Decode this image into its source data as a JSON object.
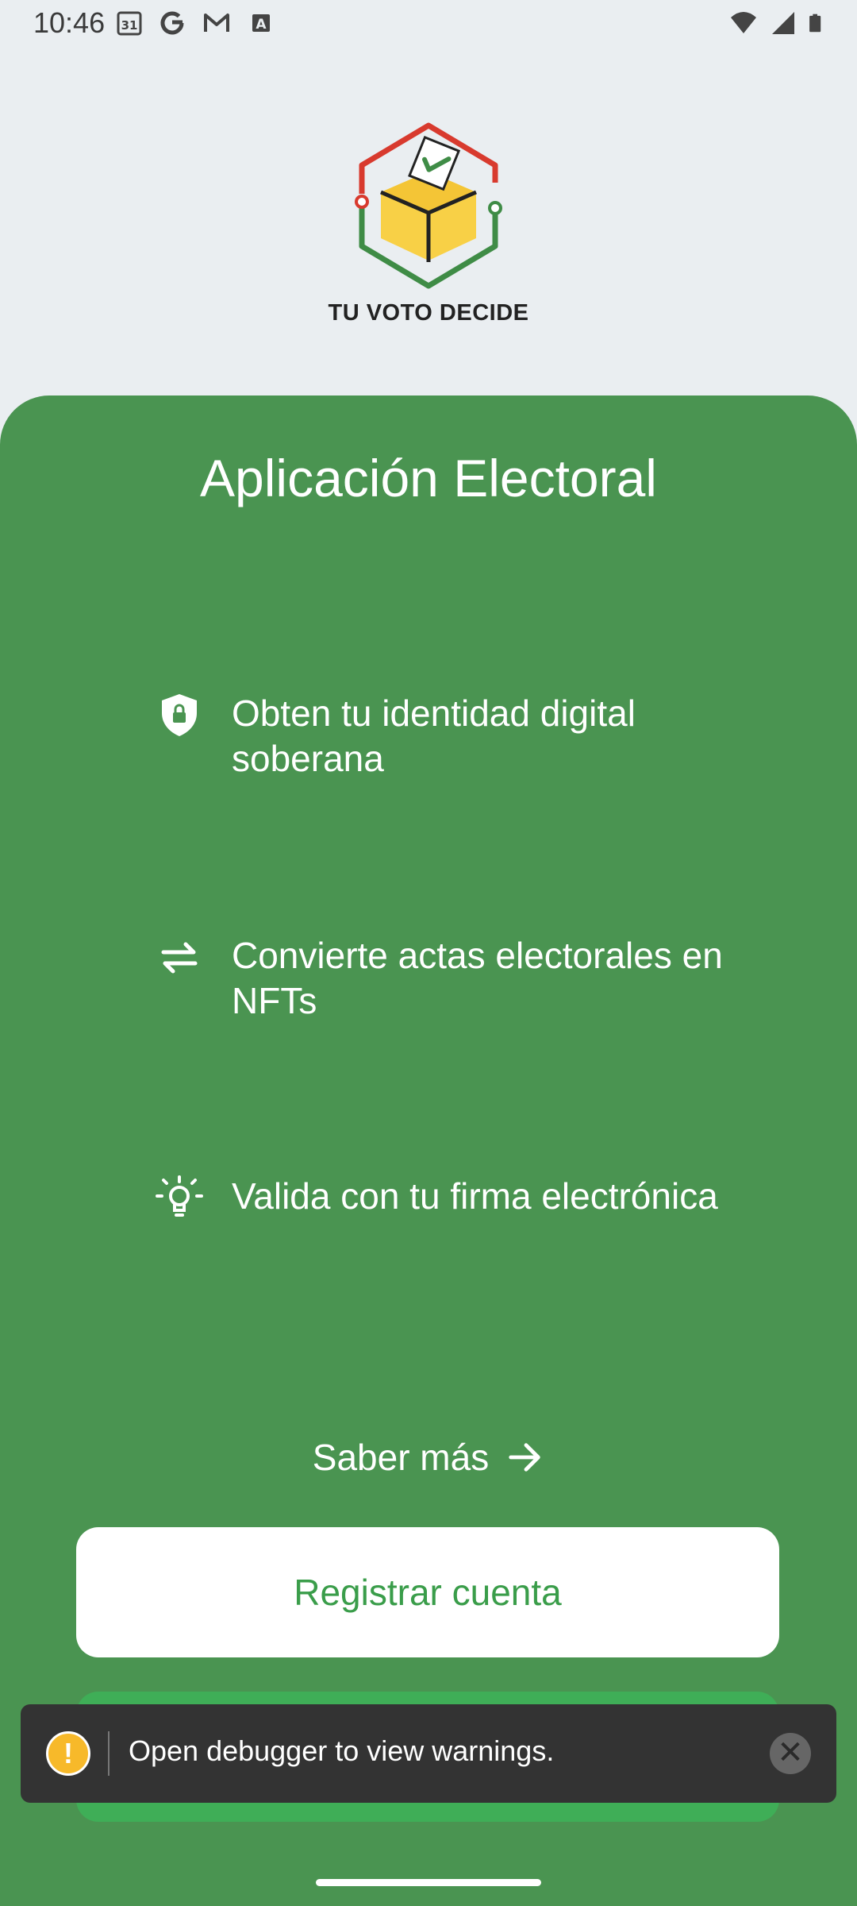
{
  "status_bar": {
    "time": "10:46",
    "left_icons": [
      "calendar-icon",
      "google-icon",
      "gmail-icon",
      "keyboard-a-icon"
    ],
    "right_icons": [
      "wifi-icon",
      "signal-icon",
      "battery-icon"
    ],
    "calendar_day": "31"
  },
  "brand": {
    "caption": "TU VOTO DECIDE"
  },
  "main": {
    "title": "Aplicación Electoral",
    "features": [
      {
        "icon": "shield-lock-icon",
        "text": "Obten tu identidad digital soberana"
      },
      {
        "icon": "swap-arrows-icon",
        "text": "Convierte actas electorales en NFTs"
      },
      {
        "icon": "lightbulb-icon",
        "text": "Valida con tu firma electrónica"
      }
    ],
    "learn_more": "Saber más",
    "register_button": "Registrar cuenta"
  },
  "debug_toast": {
    "message": "Open debugger to view warnings.",
    "warn_glyph": "!",
    "close_glyph": "✕"
  },
  "colors": {
    "background": "#eaeef1",
    "sheet_green": "#4a9451",
    "button_text_green": "#3a9d4a",
    "secondary_button": "#3fae57"
  }
}
